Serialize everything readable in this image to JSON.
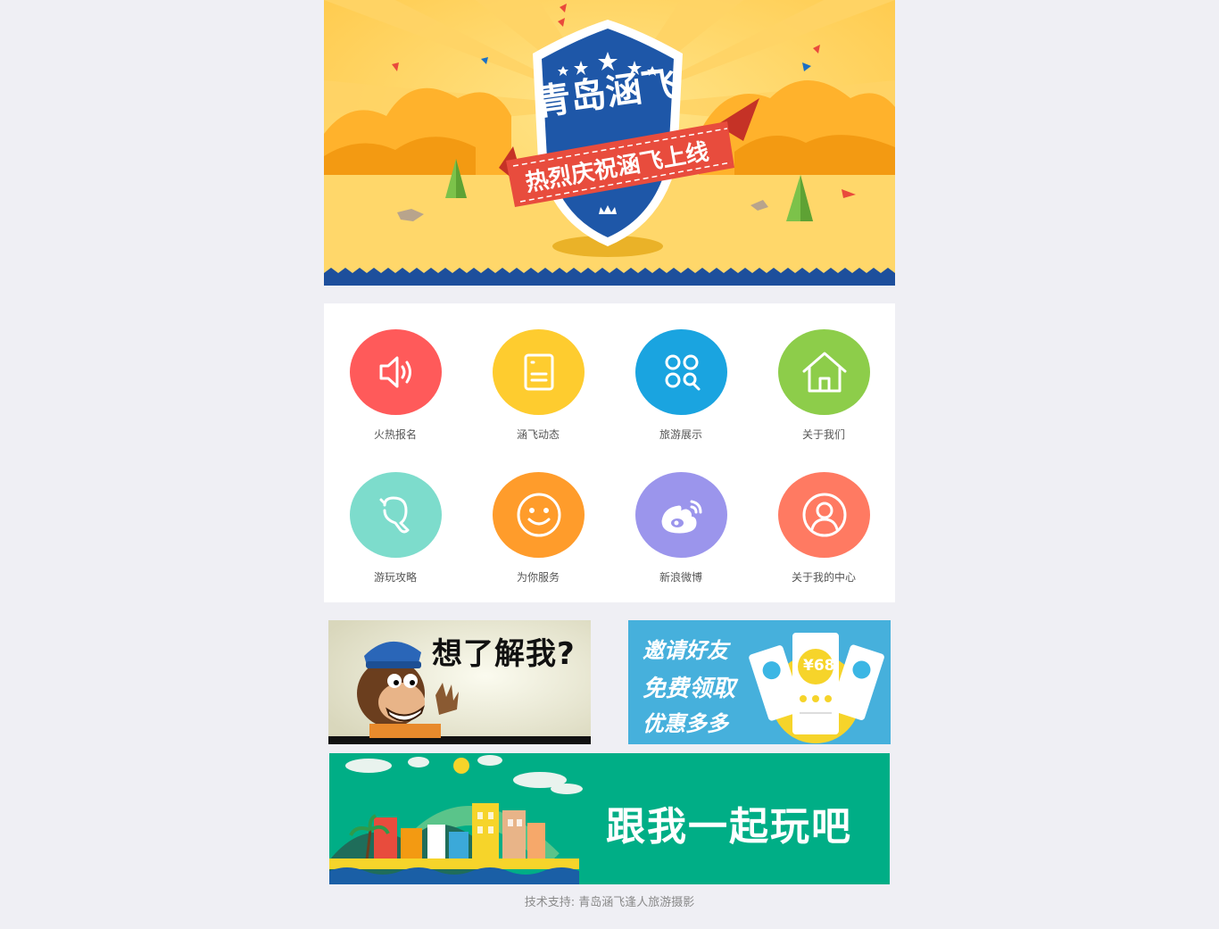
{
  "hero": {
    "title": "青岛涵飞",
    "ribbon": "热烈庆祝涵飞上线"
  },
  "menu": [
    {
      "label": "火热报名",
      "icon": "speaker-icon",
      "color": "#ff5a5a"
    },
    {
      "label": "涵飞动态",
      "icon": "document-icon",
      "color": "#fecc2f"
    },
    {
      "label": "旅游展示",
      "icon": "apps-search-icon",
      "color": "#1aa4e0"
    },
    {
      "label": "关于我们",
      "icon": "home-icon",
      "color": "#8dcd4a"
    },
    {
      "label": "游玩攻略",
      "icon": "guide-icon",
      "color": "#7ddccc"
    },
    {
      "label": "为你服务",
      "icon": "smile-icon",
      "color": "#ff9c2b"
    },
    {
      "label": "新浪微博",
      "icon": "weibo-icon",
      "color": "#9b95ec"
    },
    {
      "label": "关于我的中心",
      "icon": "user-icon",
      "color": "#ff7a62"
    }
  ],
  "promos": {
    "about_me": "想了解我?",
    "invite": {
      "line1": "邀请好友",
      "line2": "免费领取",
      "line3": "优惠多多",
      "price": "¥68"
    },
    "play": "跟我一起玩吧"
  },
  "footer": {
    "text": "技术支持: 青岛涵飞逢人旅游摄影"
  }
}
